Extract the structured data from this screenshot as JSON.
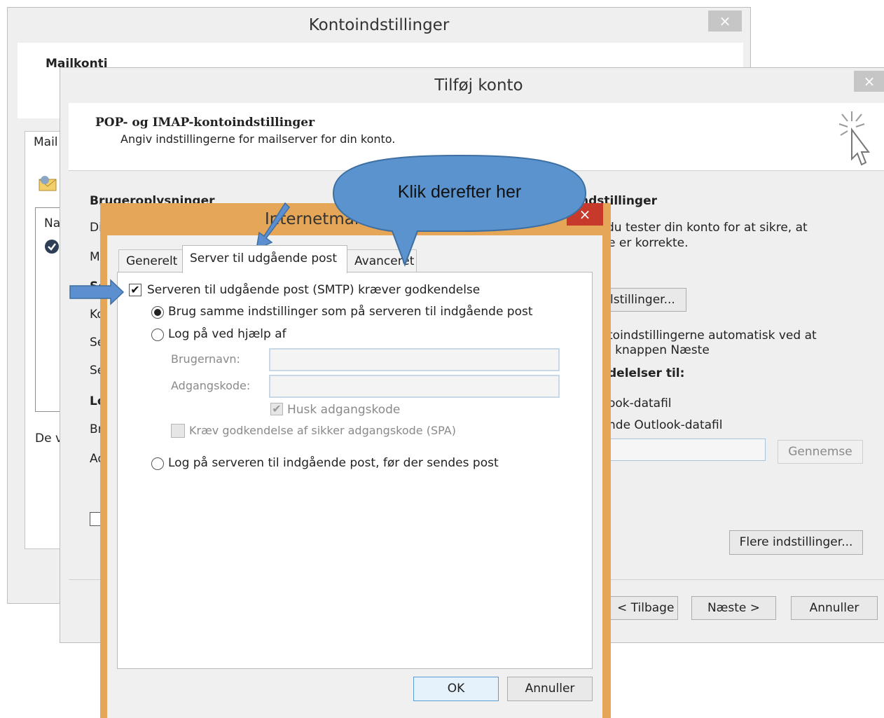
{
  "kontoindstillinger": {
    "title": "Kontoindstillinger",
    "close": "×",
    "mailkonti_heading": "Mailkonti",
    "tab_mail": "Mail",
    "col_name": "Na",
    "footer_text": "De v"
  },
  "tilfoj": {
    "title": "Tilføj konto",
    "close": "×",
    "section_title": "POP- og IMAP-kontoindstillinger",
    "section_subtitle": "Angiv indstillingerne for mailserver for din konto.",
    "left": {
      "heading": "Brugeroplysninger",
      "row1": "Di",
      "row2": "M",
      "row3": "Se",
      "row4": "Ko",
      "row5": "Se",
      "row6": "Se",
      "row7": "Lo",
      "row8": "Br",
      "row9": "Ad"
    },
    "right": {
      "heading": "ndstillinger",
      "text1a": " du tester din konto for at sikre, at",
      "text1b": "e er korrekte.",
      "test_button": "lstillinger...",
      "text2a": "toindstillingerne automatisk ved at",
      "text2b": "i knappen Næste",
      "deliver_heading": "delelser til:",
      "opt1": "ook-datafil",
      "opt2": "nde Outlook-datafil",
      "browse_button": "Gennemse",
      "more_button": "Flere indstillinger..."
    },
    "back_button": "< Tilbage",
    "next_button": "Næste >",
    "cancel_button": "Annuller"
  },
  "internet": {
    "title": "Internetmail",
    "close": "×",
    "tabs": [
      "Generelt",
      "Server til udgående post",
      "Avanceret"
    ],
    "smtp_checkbox": "Serveren til udgående post (SMTP) kræver godkendelse",
    "smtp_checked": true,
    "radio_same": "Brug samme indstillinger som på serveren til indgående post",
    "radio_logon": "Log på ved hjælp af",
    "username_label": "Brugernavn:",
    "password_label": "Adgangskode:",
    "remember_label": "Husk adgangskode",
    "spa_label": "Kræv godkendelse af sikker adgangskode (SPA)",
    "radio_incoming": "Log på serveren til indgående post, før der sendes post",
    "ok_button": "OK",
    "cancel_button": "Annuller"
  },
  "callout": {
    "text": "Klik derefter her"
  },
  "colors": {
    "dialog_border": "#e2a350",
    "close_red": "#c73a2b",
    "close_gray": "#c6c6c6",
    "callout_fill": "#5b93cf",
    "callout_stroke": "#3d6fa3",
    "arrow_fill": "#5b8fd0"
  },
  "icons": [
    "close-icon",
    "checkmark-icon",
    "wand-cursor-icon",
    "mail-icon",
    "account-check-icon",
    "arrow-icon"
  ]
}
